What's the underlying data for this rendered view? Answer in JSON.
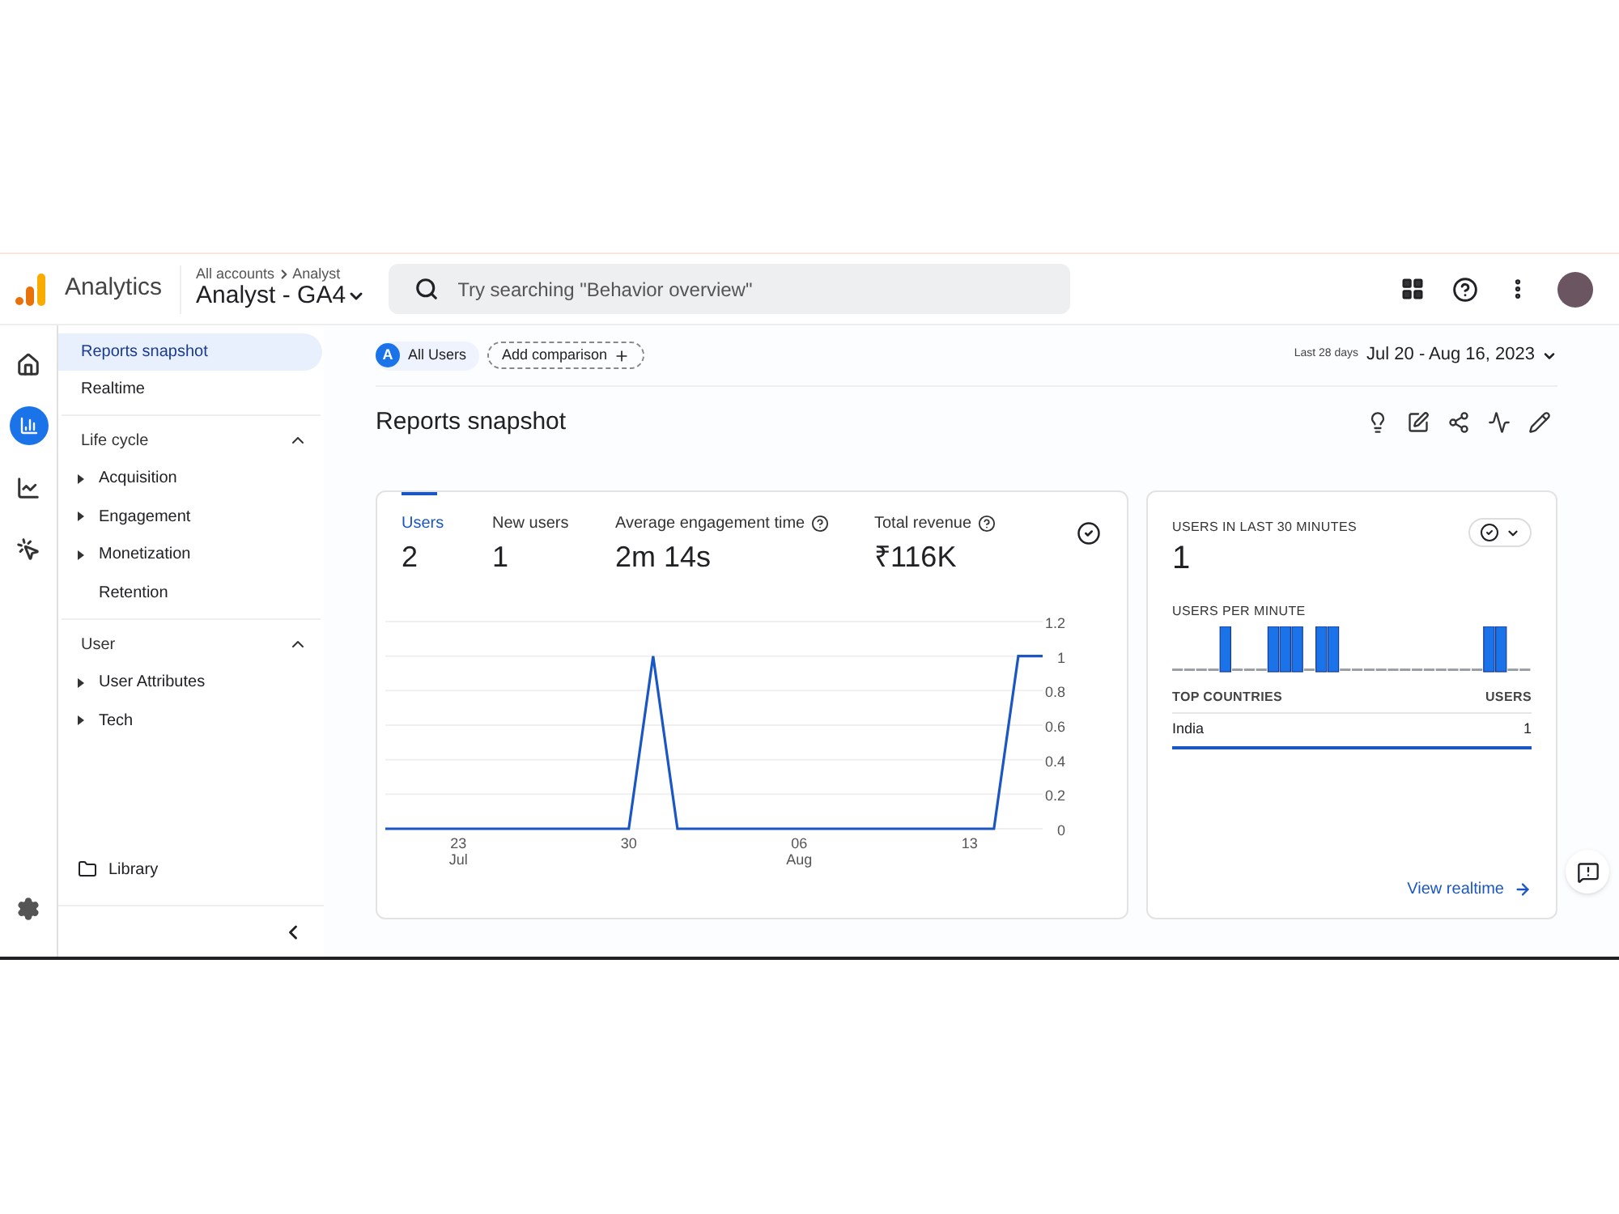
{
  "header": {
    "app_name": "Analytics",
    "breadcrumb": [
      "All accounts",
      "Analyst"
    ],
    "property": "Analyst - GA4",
    "search": {
      "placeholder": "Try searching \"Behavior overview\""
    }
  },
  "rail": [
    {
      "kind": "home",
      "selected": false
    },
    {
      "kind": "reports",
      "selected": true
    },
    {
      "kind": "explore",
      "selected": false
    },
    {
      "kind": "advertising",
      "selected": false
    }
  ],
  "nav": {
    "items": [
      {
        "label": "Reports snapshot",
        "selected": true
      },
      {
        "label": "Realtime",
        "selected": false
      }
    ],
    "sections": [
      {
        "title": "Life cycle",
        "expanded": true,
        "items": [
          {
            "label": "Acquisition",
            "expandable": true
          },
          {
            "label": "Engagement",
            "expandable": true
          },
          {
            "label": "Monetization",
            "expandable": true
          },
          {
            "label": "Retention",
            "expandable": false
          }
        ]
      },
      {
        "title": "User",
        "expanded": true,
        "items": [
          {
            "label": "User Attributes",
            "expandable": true
          },
          {
            "label": "Tech",
            "expandable": true
          }
        ]
      }
    ],
    "library": "Library"
  },
  "filters": {
    "segment_badge": "A",
    "segment": "All Users",
    "add_comparison": "Add comparison"
  },
  "date_range": {
    "label": "Last 28 days",
    "value": "Jul 20 - Aug 16, 2023"
  },
  "page_title": "Reports snapshot",
  "metrics_card": {
    "metrics": [
      {
        "label": "Users",
        "value": "2",
        "selected": true,
        "help": false
      },
      {
        "label": "New users",
        "value": "1",
        "selected": false,
        "help": false
      },
      {
        "label": "Average engagement time",
        "value": "2m 14s",
        "selected": false,
        "help": true
      },
      {
        "label": "Total revenue",
        "value": "₹116K",
        "selected": false,
        "help": true
      }
    ],
    "chart_data": {
      "type": "line",
      "categories": [
        null,
        null,
        null,
        "23\nJul",
        null,
        null,
        null,
        null,
        null,
        null,
        "30",
        null,
        null,
        null,
        null,
        null,
        null,
        "06\nAug",
        null,
        null,
        null,
        null,
        null,
        null,
        "13",
        null,
        null,
        null
      ],
      "series": [
        {
          "color": "#1a56c4",
          "values": [
            0,
            0,
            0,
            0,
            0,
            0,
            0,
            0,
            0,
            0,
            0,
            1,
            0,
            0,
            0,
            0,
            0,
            0,
            0,
            0,
            0,
            0,
            0,
            0,
            0,
            0,
            1,
            1
          ]
        }
      ],
      "ylim": [
        0,
        1.2
      ],
      "grid": true,
      "yticks": [
        {
          "value": 0,
          "label": "0"
        },
        {
          "value": 0.2,
          "label": "0.2"
        },
        {
          "value": 0.4,
          "label": "0.4"
        },
        {
          "value": 0.6,
          "label": "0.6"
        },
        {
          "value": 0.8,
          "label": "0.8"
        },
        {
          "value": 1,
          "label": "1"
        },
        {
          "value": 1.2,
          "label": "1.2"
        }
      ]
    }
  },
  "realtime_card": {
    "title": "USERS IN LAST 30 MINUTES",
    "value": "1",
    "per_minute_label": "USERS PER MINUTE",
    "table": {
      "columns": [
        "TOP COUNTRIES",
        "USERS"
      ],
      "rows": [
        {
          "country": "India",
          "users": "1"
        }
      ]
    },
    "link": "View realtime"
  }
}
